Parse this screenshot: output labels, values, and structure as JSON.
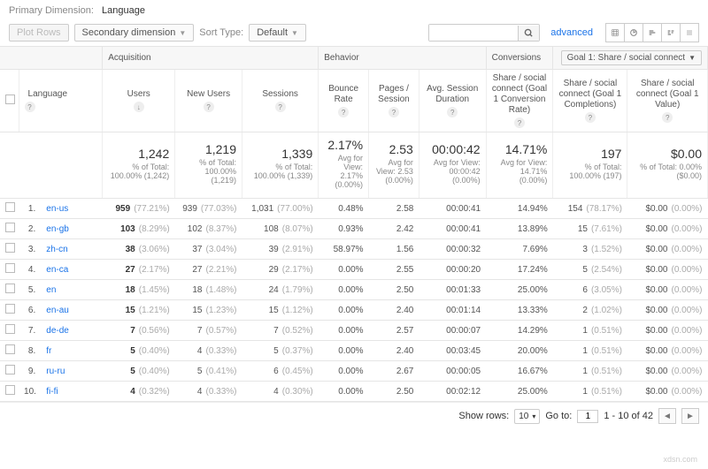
{
  "header": {
    "primary_dimension_label": "Primary Dimension:",
    "primary_dimension_value": "Language",
    "plot_rows": "Plot Rows",
    "secondary_dimension": "Secondary dimension",
    "sort_type_label": "Sort Type:",
    "sort_type_value": "Default",
    "search_placeholder": "",
    "advanced": "advanced"
  },
  "groups": {
    "acquisition": "Acquisition",
    "behavior": "Behavior",
    "conversions": "Conversions",
    "goal_selector": "Goal 1: Share / social connect"
  },
  "columns": {
    "language": "Language",
    "users": "Users",
    "new_users": "New Users",
    "sessions": "Sessions",
    "bounce": "Bounce Rate",
    "pages": "Pages / Session",
    "duration": "Avg. Session Duration",
    "conv_rate": "Share / social connect (Goal 1 Conversion Rate)",
    "completions": "Share / social connect (Goal 1 Completions)",
    "value": "Share / social connect (Goal 1 Value)"
  },
  "summary": {
    "users": {
      "big": "1,242",
      "sub": "% of Total: 100.00% (1,242)"
    },
    "new_users": {
      "big": "1,219",
      "sub": "% of Total: 100.00% (1,219)"
    },
    "sessions": {
      "big": "1,339",
      "sub": "% of Total: 100.00% (1,339)"
    },
    "bounce": {
      "big": "2.17%",
      "sub": "Avg for View: 2.17% (0.00%)"
    },
    "pages": {
      "big": "2.53",
      "sub": "Avg for View: 2.53 (0.00%)"
    },
    "duration": {
      "big": "00:00:42",
      "sub": "Avg for View: 00:00:42 (0.00%)"
    },
    "conv_rate": {
      "big": "14.71%",
      "sub": "Avg for View: 14.71% (0.00%)"
    },
    "completions": {
      "big": "197",
      "sub": "% of Total: 100.00% (197)"
    },
    "value": {
      "big": "$0.00",
      "sub": "% of Total: 0.00% ($0.00)"
    }
  },
  "rows": [
    {
      "rank": "1.",
      "lang": "en-us",
      "users": "959",
      "users_pct": "(77.21%)",
      "new": "939",
      "new_pct": "(77.03%)",
      "sess": "1,031",
      "sess_pct": "(77.00%)",
      "bounce": "0.48%",
      "pages": "2.58",
      "dur": "00:00:41",
      "rate": "14.94%",
      "comp": "154",
      "comp_pct": "(78.17%)",
      "val": "$0.00",
      "val_pct": "(0.00%)"
    },
    {
      "rank": "2.",
      "lang": "en-gb",
      "users": "103",
      "users_pct": "(8.29%)",
      "new": "102",
      "new_pct": "(8.37%)",
      "sess": "108",
      "sess_pct": "(8.07%)",
      "bounce": "0.93%",
      "pages": "2.42",
      "dur": "00:00:41",
      "rate": "13.89%",
      "comp": "15",
      "comp_pct": "(7.61%)",
      "val": "$0.00",
      "val_pct": "(0.00%)"
    },
    {
      "rank": "3.",
      "lang": "zh-cn",
      "users": "38",
      "users_pct": "(3.06%)",
      "new": "37",
      "new_pct": "(3.04%)",
      "sess": "39",
      "sess_pct": "(2.91%)",
      "bounce": "58.97%",
      "pages": "1.56",
      "dur": "00:00:32",
      "rate": "7.69%",
      "comp": "3",
      "comp_pct": "(1.52%)",
      "val": "$0.00",
      "val_pct": "(0.00%)"
    },
    {
      "rank": "4.",
      "lang": "en-ca",
      "users": "27",
      "users_pct": "(2.17%)",
      "new": "27",
      "new_pct": "(2.21%)",
      "sess": "29",
      "sess_pct": "(2.17%)",
      "bounce": "0.00%",
      "pages": "2.55",
      "dur": "00:00:20",
      "rate": "17.24%",
      "comp": "5",
      "comp_pct": "(2.54%)",
      "val": "$0.00",
      "val_pct": "(0.00%)"
    },
    {
      "rank": "5.",
      "lang": "en",
      "users": "18",
      "users_pct": "(1.45%)",
      "new": "18",
      "new_pct": "(1.48%)",
      "sess": "24",
      "sess_pct": "(1.79%)",
      "bounce": "0.00%",
      "pages": "2.50",
      "dur": "00:01:33",
      "rate": "25.00%",
      "comp": "6",
      "comp_pct": "(3.05%)",
      "val": "$0.00",
      "val_pct": "(0.00%)"
    },
    {
      "rank": "6.",
      "lang": "en-au",
      "users": "15",
      "users_pct": "(1.21%)",
      "new": "15",
      "new_pct": "(1.23%)",
      "sess": "15",
      "sess_pct": "(1.12%)",
      "bounce": "0.00%",
      "pages": "2.40",
      "dur": "00:01:14",
      "rate": "13.33%",
      "comp": "2",
      "comp_pct": "(1.02%)",
      "val": "$0.00",
      "val_pct": "(0.00%)"
    },
    {
      "rank": "7.",
      "lang": "de-de",
      "users": "7",
      "users_pct": "(0.56%)",
      "new": "7",
      "new_pct": "(0.57%)",
      "sess": "7",
      "sess_pct": "(0.52%)",
      "bounce": "0.00%",
      "pages": "2.57",
      "dur": "00:00:07",
      "rate": "14.29%",
      "comp": "1",
      "comp_pct": "(0.51%)",
      "val": "$0.00",
      "val_pct": "(0.00%)"
    },
    {
      "rank": "8.",
      "lang": "fr",
      "users": "5",
      "users_pct": "(0.40%)",
      "new": "4",
      "new_pct": "(0.33%)",
      "sess": "5",
      "sess_pct": "(0.37%)",
      "bounce": "0.00%",
      "pages": "2.40",
      "dur": "00:03:45",
      "rate": "20.00%",
      "comp": "1",
      "comp_pct": "(0.51%)",
      "val": "$0.00",
      "val_pct": "(0.00%)"
    },
    {
      "rank": "9.",
      "lang": "ru-ru",
      "users": "5",
      "users_pct": "(0.40%)",
      "new": "5",
      "new_pct": "(0.41%)",
      "sess": "6",
      "sess_pct": "(0.45%)",
      "bounce": "0.00%",
      "pages": "2.67",
      "dur": "00:00:05",
      "rate": "16.67%",
      "comp": "1",
      "comp_pct": "(0.51%)",
      "val": "$0.00",
      "val_pct": "(0.00%)"
    },
    {
      "rank": "10.",
      "lang": "fi-fi",
      "users": "4",
      "users_pct": "(0.32%)",
      "new": "4",
      "new_pct": "(0.33%)",
      "sess": "4",
      "sess_pct": "(0.30%)",
      "bounce": "0.00%",
      "pages": "2.50",
      "dur": "00:02:12",
      "rate": "25.00%",
      "comp": "1",
      "comp_pct": "(0.51%)",
      "val": "$0.00",
      "val_pct": "(0.00%)"
    }
  ],
  "footer": {
    "show_rows": "Show rows:",
    "rows_value": "10",
    "goto": "Go to:",
    "goto_value": "1",
    "range": "1 - 10 of 42"
  },
  "watermark": "xdsn.com"
}
